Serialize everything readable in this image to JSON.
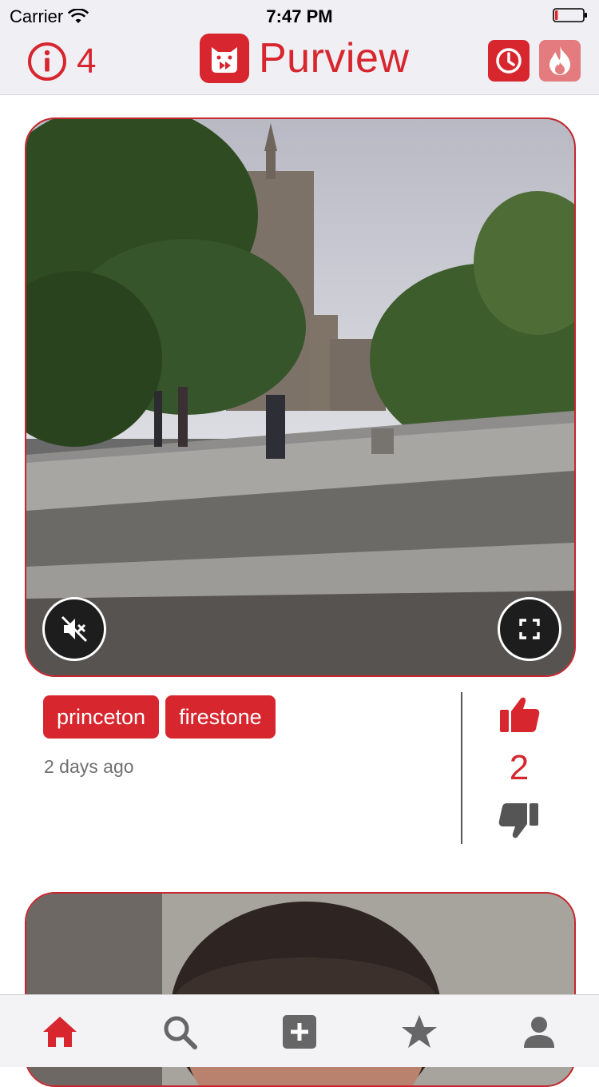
{
  "status_bar": {
    "carrier": "Carrier",
    "time": "7:47 PM",
    "battery_level": 0.1
  },
  "header": {
    "info_count": "4",
    "app_title": "Purview",
    "buttons": [
      {
        "icon": "clock-icon",
        "active": true
      },
      {
        "icon": "fire-icon",
        "active": false
      }
    ]
  },
  "post": {
    "media_icons": {
      "mute": "mute-icon",
      "fullscreen": "fullscreen-icon"
    },
    "tags": [
      "princeton",
      "firestone"
    ],
    "time_ago": "2 days ago",
    "votes": "2"
  },
  "tabbar": {
    "items": [
      {
        "icon": "home-icon",
        "active": true
      },
      {
        "icon": "search-icon",
        "active": false
      },
      {
        "icon": "add-icon",
        "active": false
      },
      {
        "icon": "star-icon",
        "active": false
      },
      {
        "icon": "profile-icon",
        "active": false
      }
    ]
  },
  "colors": {
    "accent": "#d7262e",
    "accent_light": "#e47c7f",
    "bar_bg": "#efeff4",
    "inactive": "#666666"
  }
}
